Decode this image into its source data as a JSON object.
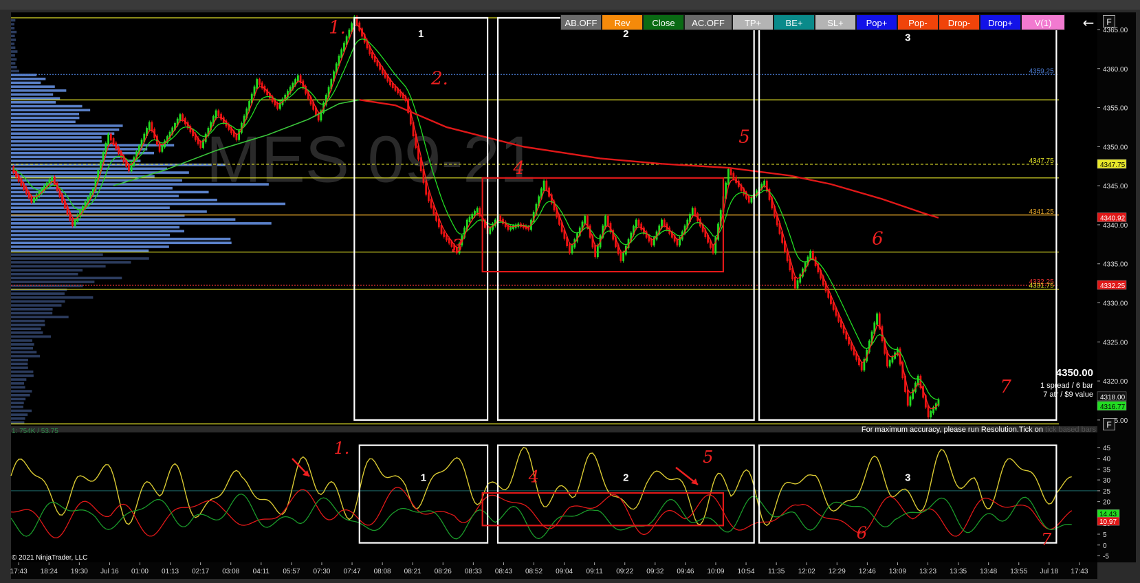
{
  "toolbar": {
    "buttons": [
      {
        "label": "AB.OFF",
        "bg": "#6a6a6a",
        "w": 60
      },
      {
        "label": "Rev",
        "bg": "#f58a0a",
        "w": 60
      },
      {
        "label": "Close",
        "bg": "#0a6a14",
        "w": 60
      },
      {
        "label": "AC.OFF",
        "bg": "#6a6a6a",
        "w": 70
      },
      {
        "label": "TP+",
        "bg": "#b4b4b4",
        "w": 60
      },
      {
        "label": "BE+",
        "bg": "#0a8a8a",
        "w": 60
      },
      {
        "label": "SL+",
        "bg": "#b4b4b4",
        "w": 60
      },
      {
        "label": "Pop+",
        "bg": "#1212e8",
        "w": 60
      },
      {
        "label": "Pop-",
        "bg": "#f0440a",
        "w": 60
      },
      {
        "label": "Drop-",
        "bg": "#f0440a",
        "w": 60
      },
      {
        "label": "Drop+",
        "bg": "#1212e8",
        "w": 60
      },
      {
        "label": "V(1)",
        "bg": "#f27ad0",
        "w": 64
      }
    ],
    "back_arrow": "←",
    "panel_button": "F"
  },
  "chart_data": [
    {
      "type": "candlestick",
      "watermark": "MES 09-21",
      "y_axis_ticks": [
        4365.0,
        4360.0,
        4355.0,
        4350.0,
        4345.0,
        4340.0,
        4335.0,
        4330.0,
        4325.0,
        4320.0,
        4315.0
      ],
      "ylim": [
        4314.2,
        4367.2
      ],
      "x_axis_ticks": [
        "17:43",
        "18:24",
        "19:30",
        "Jul 16",
        "01:00",
        "01:13",
        "02:17",
        "03:08",
        "04:11",
        "05:57",
        "07:30",
        "07:47",
        "08:08",
        "08:21",
        "08:26",
        "08:33",
        "08:43",
        "08:52",
        "09:04",
        "09:11",
        "09:22",
        "09:32",
        "09:46",
        "10:09",
        "10:54",
        "11:35",
        "12:02",
        "12:29",
        "12:46",
        "13:09",
        "13:23",
        "13:35",
        "13:48",
        "13:55",
        "Jul 18",
        "17:43"
      ],
      "price_series": {
        "name": "price",
        "x": [
          0,
          4,
          8,
          12,
          16,
          19,
          23,
          27,
          29,
          33,
          37,
          40,
          44,
          48,
          52,
          56,
          60,
          64,
          67,
          70,
          74,
          77,
          79,
          81,
          84,
          87,
          89,
          91,
          93,
          95,
          97,
          99,
          101,
          104,
          106,
          109,
          112,
          114,
          116,
          119,
          122,
          125,
          127,
          130,
          133,
          137,
          140,
          144,
          147,
          150,
          153,
          156,
          160,
          163,
          166,
          169,
          171,
          173,
          175,
          177,
          179,
          181
        ],
        "close": [
          4347.3,
          4343.0,
          4346.0,
          4340.0,
          4344.5,
          4351.5,
          4347.0,
          4353.0,
          4349.5,
          4354.0,
          4350.0,
          4354.5,
          4351.0,
          4358.5,
          4355.0,
          4359.0,
          4353.5,
          4361.5,
          4366.5,
          4362.0,
          4358.0,
          4356.0,
          4350.0,
          4344.0,
          4339.0,
          4336.5,
          4340.5,
          4342.0,
          4339.0,
          4341.0,
          4339.5,
          4340.0,
          4339.5,
          4345.5,
          4342.0,
          4336.5,
          4341.0,
          4336.0,
          4341.0,
          4335.5,
          4340.5,
          4337.5,
          4340.5,
          4337.5,
          4342.0,
          4336.5,
          4347.0,
          4343.0,
          4345.5,
          4339.0,
          4332.0,
          4336.5,
          4330.0,
          4325.5,
          4321.5,
          4328.5,
          4322.0,
          4324.0,
          4317.0,
          4320.5,
          4315.5,
          4317.5
        ]
      },
      "fast_ma": {
        "name": "fast MA",
        "color": "#ff2222"
      },
      "slow_ma": {
        "name": "slow MA",
        "color": "#22dd22"
      },
      "long_ma": {
        "name": "long MA",
        "color": "#e01818",
        "x": [
          68,
          75,
          85,
          100,
          115,
          127,
          140,
          152,
          160,
          170,
          178,
          181
        ],
        "y": [
          4356.0,
          4355.3,
          4352.5,
          4350.0,
          4348.5,
          4347.8,
          4347.3,
          4346.3,
          4345.2,
          4343.3,
          4341.5,
          4340.9
        ]
      },
      "horizontal_levels": [
        {
          "price": 4366.5,
          "color": "#e8e82a",
          "style": "solid"
        },
        {
          "price": 4356.0,
          "color": "#e8e82a",
          "style": "solid"
        },
        {
          "price": 4347.75,
          "color": "#e8e82a",
          "style": "dashed",
          "label": "4347.75"
        },
        {
          "price": 4346.0,
          "color": "#e8e82a",
          "style": "solid"
        },
        {
          "price": 4341.25,
          "color": "#e8a82a",
          "style": "solid",
          "label": "4341.25"
        },
        {
          "price": 4336.5,
          "color": "#e8e82a",
          "style": "solid"
        },
        {
          "price": 4332.25,
          "color": "#e83030",
          "style": "dotted",
          "label": "4332.25"
        },
        {
          "price": 4331.75,
          "color": "#e8e82a",
          "style": "solid",
          "label": "4331.75"
        },
        {
          "price": 4359.25,
          "color": "#4a7ad0",
          "style": "dotted",
          "label": "4359.25"
        },
        {
          "price": 4314.5,
          "color": "#e8e82a",
          "style": "solid"
        }
      ],
      "price_tags": [
        {
          "price": 4347.75,
          "text": "4347.75",
          "bg": "#e8e82a",
          "fg": "#000000"
        },
        {
          "price": 4340.92,
          "text": "4340.92",
          "bg": "#e01818",
          "fg": "#ffffff"
        },
        {
          "price": 4332.25,
          "text": "4332.25",
          "bg": "#e01818",
          "fg": "#ffffff"
        },
        {
          "price": 4318.0,
          "text": "4318.00",
          "bg": "#111111",
          "fg": "#ffffff"
        },
        {
          "price": 4316.77,
          "text": "4316.77",
          "bg": "#22dd22",
          "fg": "#000000"
        }
      ],
      "volume_profile": {
        "note_text": "1: 754K / 53.75",
        "value_area": [
          4336.5,
          4359.5
        ]
      },
      "boxes": [
        {
          "label": "1",
          "x0": 67,
          "x1": 93,
          "p0": 4366.5,
          "p1": 4315.0,
          "color": "#ffffff"
        },
        {
          "label": "2",
          "x0": 95,
          "x1": 145,
          "p0": 4366.5,
          "p1": 4315.0,
          "color": "#ffffff"
        },
        {
          "label": "3",
          "x0": 146,
          "x1": 204,
          "p0": 4366.0,
          "p1": 4315.0,
          "color": "#ffffff"
        },
        {
          "label": "",
          "x0": 92,
          "x1": 139,
          "p0": 4346.0,
          "p1": 4334.0,
          "color": "#e01818"
        }
      ],
      "annotations": [
        {
          "text": "1.",
          "x": 62,
          "p": 4364.5
        },
        {
          "text": "2.",
          "x": 82,
          "p": 4358.0
        },
        {
          "text": "3",
          "x": 86,
          "p": 4336.5
        },
        {
          "text": "4",
          "x": 98,
          "p": 4346.5
        },
        {
          "text": "5",
          "x": 142,
          "p": 4350.5
        },
        {
          "text": "6",
          "x": 168,
          "p": 4337.5
        },
        {
          "text": "7",
          "x": 193,
          "p": 4318.5
        }
      ],
      "info_box": {
        "price": "4350.00",
        "line1": "1 spread / 6 bar",
        "line2": "7 atr / $9 value"
      },
      "footer_note": {
        "main": "For maximum accuracy, please run Resolution.Tick on",
        "dim": "tick based bars"
      }
    },
    {
      "type": "line",
      "y_axis_ticks": [
        45,
        40,
        35,
        30,
        25,
        20,
        15,
        10,
        5,
        0,
        -5
      ],
      "ylim": [
        -8,
        50
      ],
      "reference_line": 25,
      "series": [
        {
          "name": "yellow",
          "color": "#d8c832",
          "tag": "14.43",
          "tag_bg": "#22dd22",
          "tag_fg": "#000000"
        },
        {
          "name": "red",
          "color": "#e01818",
          "tag": "10.97",
          "tag_bg": "#e01818",
          "tag_fg": "#ffffff"
        },
        {
          "name": "green",
          "color": "#1a9a2a"
        }
      ],
      "boxes": [
        {
          "label": "1",
          "x0": 68,
          "x1": 93,
          "v0": 46,
          "v1": 1,
          "color": "#ffffff"
        },
        {
          "label": "2",
          "x0": 95,
          "x1": 145,
          "v0": 46,
          "v1": 1,
          "color": "#ffffff"
        },
        {
          "label": "3",
          "x0": 146,
          "x1": 204,
          "v0": 46,
          "v1": 1,
          "color": "#ffffff"
        },
        {
          "label": "",
          "x0": 92,
          "x1": 139,
          "v0": 24,
          "v1": 9,
          "color": "#e01818"
        }
      ],
      "annotations": [
        {
          "text": "1.",
          "x": 63,
          "v": 42
        },
        {
          "text": "4",
          "x": 101,
          "v": 29
        },
        {
          "text": "5",
          "x": 135,
          "v": 38
        },
        {
          "text": "6",
          "x": 165,
          "v": 3
        },
        {
          "text": "7",
          "x": 201,
          "v": 0
        }
      ]
    }
  ],
  "copyright": "© 2021 NinjaTrader, LLC"
}
